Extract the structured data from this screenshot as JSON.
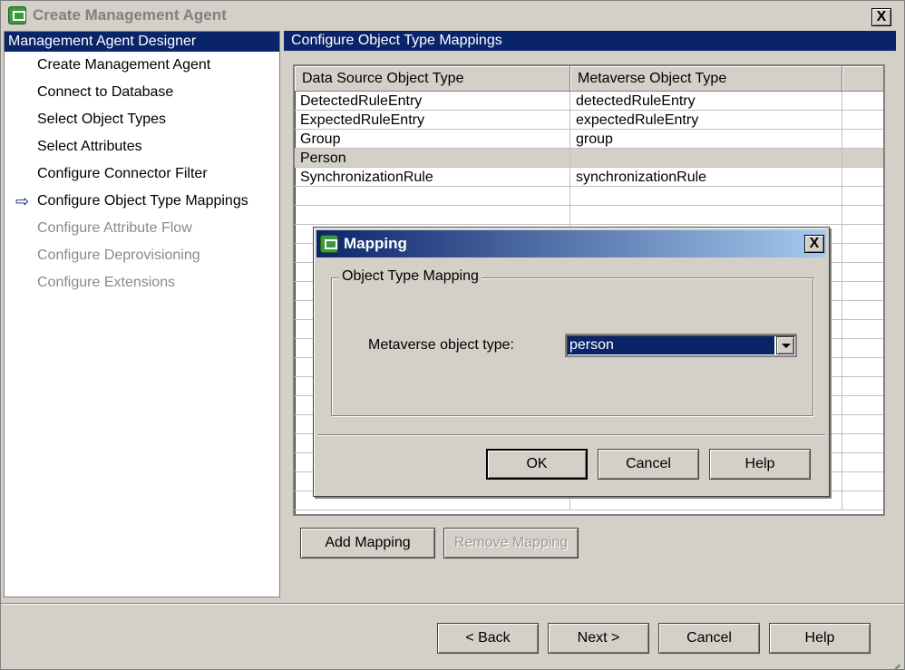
{
  "window": {
    "title": "Create Management Agent",
    "close_label": "X"
  },
  "left_panel": {
    "header": "Management Agent Designer",
    "steps": [
      {
        "label": "Create Management Agent",
        "state": "done"
      },
      {
        "label": "Connect to Database",
        "state": "done"
      },
      {
        "label": "Select Object Types",
        "state": "done"
      },
      {
        "label": "Select Attributes",
        "state": "done"
      },
      {
        "label": "Configure Connector Filter",
        "state": "done"
      },
      {
        "label": "Configure Object Type Mappings",
        "state": "current"
      },
      {
        "label": "Configure Attribute Flow",
        "state": "future"
      },
      {
        "label": "Configure Deprovisioning",
        "state": "future"
      },
      {
        "label": "Configure Extensions",
        "state": "future"
      }
    ],
    "current_marker": "⇨"
  },
  "right_panel": {
    "header": "Configure Object Type Mappings",
    "grid": {
      "columns": [
        "Data Source Object Type",
        "Metaverse Object Type"
      ],
      "rows": [
        [
          "DetectedRuleEntry",
          "detectedRuleEntry"
        ],
        [
          "ExpectedRuleEntry",
          "expectedRuleEntry"
        ],
        [
          "Group",
          "group"
        ],
        [
          "Person",
          ""
        ],
        [
          "SynchronizationRule",
          "synchronizationRule"
        ]
      ],
      "selected_row_index": 3
    },
    "add_mapping_label": "Add Mapping",
    "remove_mapping_label": "Remove Mapping"
  },
  "footer": {
    "back_label": "< Back",
    "next_label": "Next >",
    "cancel_label": "Cancel",
    "help_label": "Help"
  },
  "dialog": {
    "title": "Mapping",
    "close_label": "X",
    "group_label": "Object Type Mapping",
    "field_label": "Metaverse object type:",
    "field_value": "person",
    "ok_label": "OK",
    "cancel_label": "Cancel",
    "help_label": "Help"
  },
  "colors": {
    "title_bar_active": "#0a246a",
    "selection": "#0a246a",
    "face": "#d4d0c8",
    "app_icon": "#3a9a3a"
  }
}
